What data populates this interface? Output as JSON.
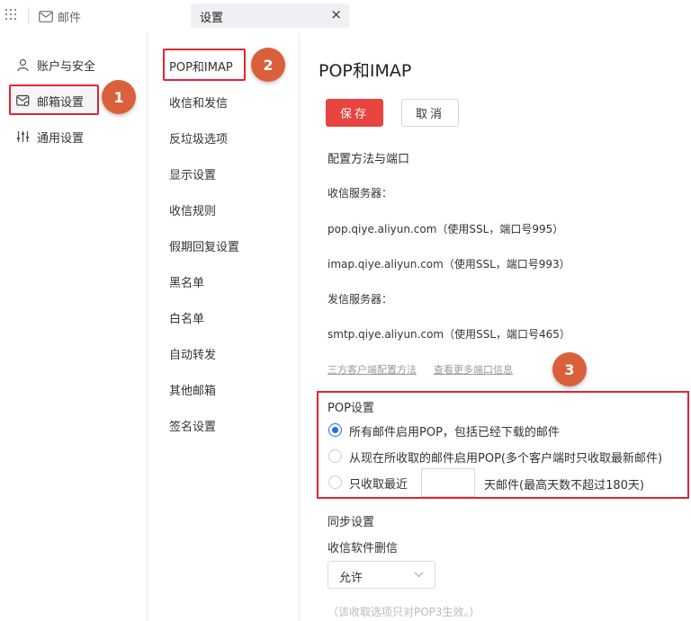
{
  "topbar": {
    "mail_tab": "邮件",
    "settings_tab": "设置",
    "close_symbol": "×"
  },
  "left_nav": [
    {
      "label": "账户与安全",
      "icon": "user-icon"
    },
    {
      "label": "邮箱设置",
      "icon": "mailbox-settings-icon",
      "selected": true
    },
    {
      "label": "通用设置",
      "icon": "sliders-icon"
    }
  ],
  "mid_nav": [
    {
      "label": "POP和IMAP",
      "selected": true
    },
    {
      "label": "收信和发信"
    },
    {
      "label": "反垃圾选项"
    },
    {
      "label": "显示设置"
    },
    {
      "label": "收信规则"
    },
    {
      "label": "假期回复设置"
    },
    {
      "label": "黑名单"
    },
    {
      "label": "白名单"
    },
    {
      "label": "自动转发"
    },
    {
      "label": "其他邮箱"
    },
    {
      "label": "签名设置"
    }
  ],
  "badges": [
    "1",
    "2",
    "3"
  ],
  "main": {
    "title": "POP和IMAP",
    "save_label": "保存",
    "cancel_label": "取消",
    "config_heading": "配置方法与端口",
    "incoming_label": "收信服务器：",
    "pop_server": "pop.qiye.aliyun.com（使用SSL，端口号995）",
    "imap_server": "imap.qiye.aliyun.com（使用SSL，端口号993）",
    "outgoing_label": "发信服务器：",
    "smtp_server": "smtp.qiye.aliyun.com（使用SSL，端口号465）",
    "link_third_party": "三方客户端配置方法",
    "link_more_ports": "查看更多端口信息",
    "pop_settings": {
      "title": "POP设置",
      "option1": "所有邮件启用POP，包括已经下载的邮件",
      "option2": "从现在所收取的邮件启用POP(多个客户端时只收取最新邮件)",
      "option3_prefix": "只收取最近",
      "option3_days_value": "",
      "option3_suffix": "天邮件(最高天数不超过180天)",
      "selected_option": 1
    },
    "sync_heading": "同步设置",
    "delete_heading": "收信软件删信",
    "delete_select_value": "允许",
    "footnote": "（该收取选项只对POP3生效。）"
  },
  "colors": {
    "primary_red": "#e8433e",
    "highlight_border": "#e0252f",
    "badge": "#d9603b",
    "radio_blue": "#1f6fe0"
  }
}
